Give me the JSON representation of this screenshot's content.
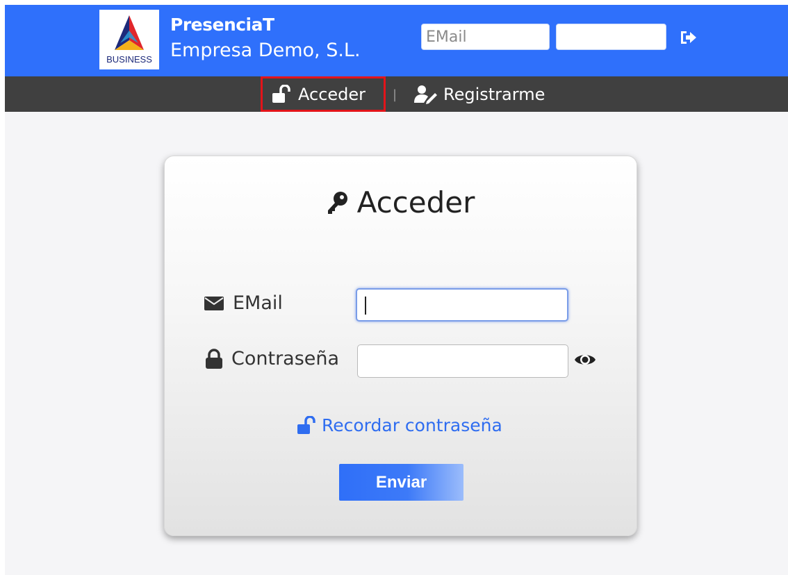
{
  "header": {
    "logo_text": "BUSINESS",
    "brand": "PresenciaT",
    "company": "Empresa Demo, S.L.",
    "email_placeholder": "EMail",
    "password_placeholder": "",
    "login_icon": "sign-in-icon",
    "background": "#2f70fb"
  },
  "nav": {
    "acceder_label": "Acceder",
    "acceder_icon": "unlock-icon",
    "separator": "|",
    "registrarme_label": "Registrarme",
    "registrarme_icon": "user-edit-icon",
    "highlight_color": "#e3141a"
  },
  "login_card": {
    "title": "Acceder",
    "title_icon": "key-icon",
    "email_label": "EMail",
    "email_icon": "envelope-icon",
    "email_value": "",
    "password_label": "Contraseña",
    "password_icon": "lock-icon",
    "password_value": "",
    "show_password_icon": "eye-icon",
    "remember_label": "Recordar contraseña",
    "remember_icon": "unlock-icon",
    "submit_label": "Enviar"
  }
}
